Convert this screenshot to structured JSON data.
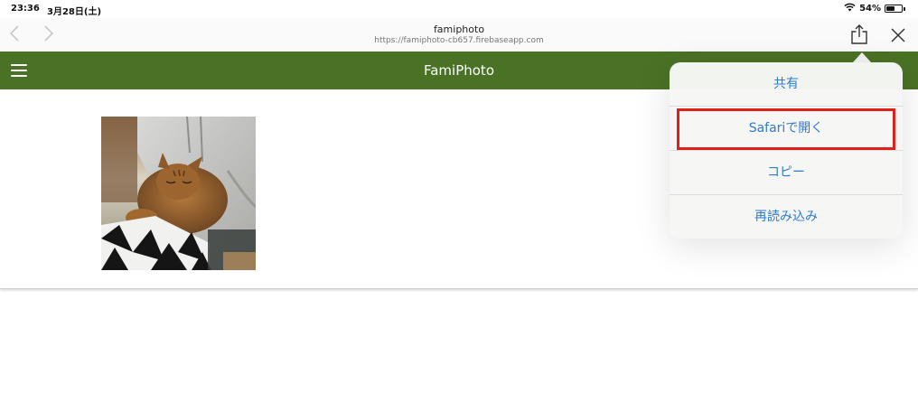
{
  "status_bar": {
    "time": "23:36",
    "date": "3月28日(土)",
    "battery": "54%",
    "battery_level": 0.54
  },
  "browser": {
    "site_title": "famiphoto",
    "url": "https://famiphoto-cb657.firebaseapp.com"
  },
  "app": {
    "title": "FamiPhoto"
  },
  "share_menu": {
    "items": [
      {
        "label": "共有"
      },
      {
        "label": "Safariで開く"
      },
      {
        "label": "コピー"
      },
      {
        "label": "再読み込み"
      }
    ],
    "highlighted_index": 1,
    "highlight_color": "#e0201a",
    "text_color": "#2f7ad1"
  },
  "colors": {
    "header": "#4a7225"
  },
  "icons": {
    "back": "chevron-left-icon",
    "forward": "chevron-right-icon",
    "share": "share-icon",
    "close": "close-icon",
    "menu": "hamburger-menu-icon",
    "wifi": "wifi-icon",
    "battery": "battery-icon"
  }
}
